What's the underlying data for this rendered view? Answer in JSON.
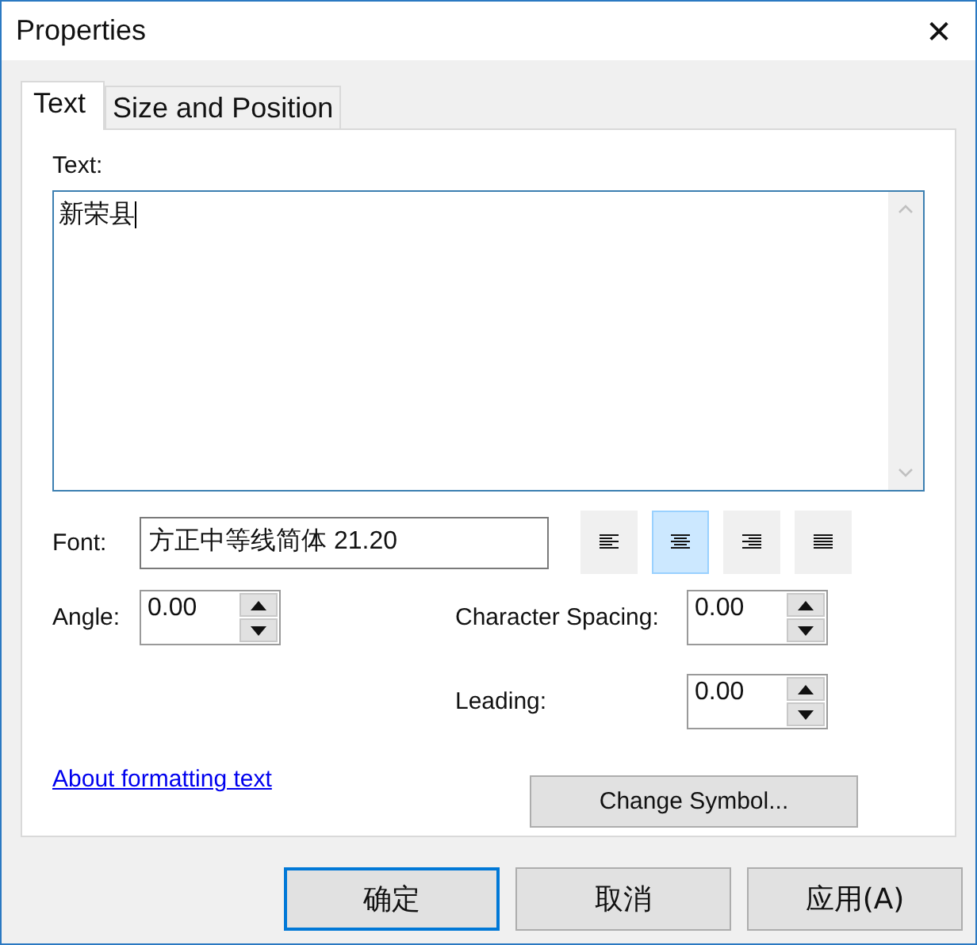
{
  "window": {
    "title": "Properties",
    "close": "✕"
  },
  "tabs": [
    {
      "label": "Text",
      "selected": true
    },
    {
      "label": "Size and Position",
      "selected": false
    }
  ],
  "text_label": "Text:",
  "text_value": "新荣县",
  "font": {
    "label": "Font:",
    "value": "方正中等线简体 21.20"
  },
  "alignment": [
    {
      "kind": "left",
      "selected": false
    },
    {
      "kind": "center",
      "selected": true
    },
    {
      "kind": "right",
      "selected": false
    },
    {
      "kind": "justify",
      "selected": false
    }
  ],
  "angle": {
    "label": "Angle:",
    "value": "0.00"
  },
  "character_spacing": {
    "label": "Character Spacing:",
    "value": "0.00"
  },
  "leading": {
    "label": "Leading:",
    "value": "0.00"
  },
  "help_link": "About formatting text",
  "change_symbol_button": "Change Symbol...",
  "buttons": [
    {
      "label": "确定",
      "default": true
    },
    {
      "label": "取消",
      "default": false
    },
    {
      "label": "应用(A)",
      "default": false
    }
  ]
}
